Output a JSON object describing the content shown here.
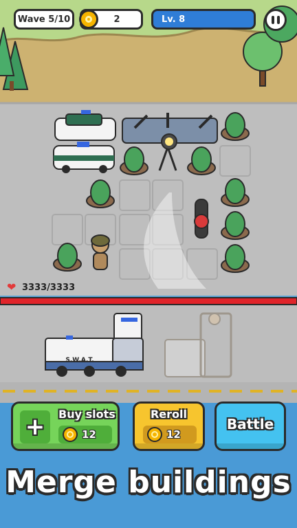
{
  "hud": {
    "wave_label": "Wave 5/10",
    "coins": "2",
    "level_label": "Lv. 8"
  },
  "base": {
    "health": "3333/3333",
    "health_fraction": 1.0
  },
  "vehicle": {
    "swat_label": "S.W.A.T."
  },
  "actions": {
    "buy_slots_label": "Buy slots",
    "buy_slots_price": "12",
    "reroll_label": "Reroll",
    "reroll_price": "12",
    "battle_label": "Battle"
  },
  "banner": "Merge buildings",
  "colors": {
    "grass": "#c9ae6c",
    "road": "#bdbdbd",
    "health_bar": "#e0242a",
    "buy_button": "#76d45a",
    "reroll_button": "#f7c52e",
    "battle_button": "#44c2f0",
    "level_bar": "#2f7dd7"
  }
}
